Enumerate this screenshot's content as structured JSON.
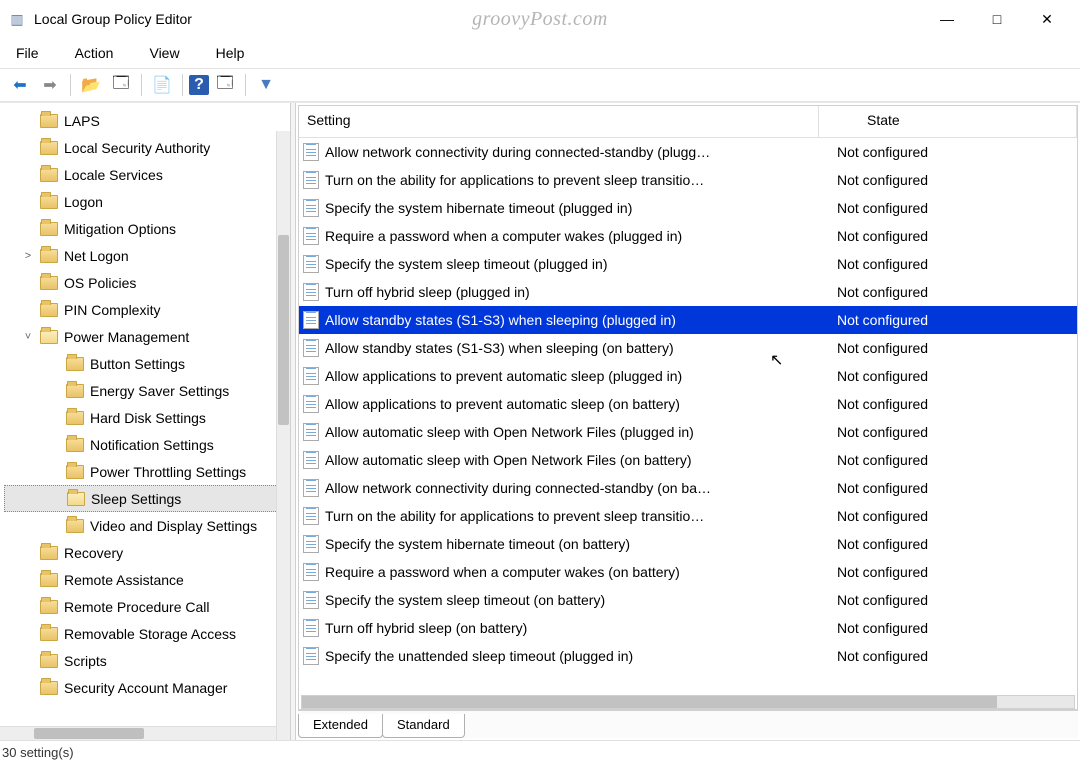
{
  "window": {
    "title": "Local Group Policy Editor",
    "watermark": "groovyPost.com"
  },
  "menubar": [
    "File",
    "Action",
    "View",
    "Help"
  ],
  "toolbar_icons": [
    "back",
    "forward",
    "up",
    "show-hide-tree",
    "export-list",
    "help",
    "show-hide-action",
    "filter"
  ],
  "tree": {
    "items": [
      {
        "label": "LAPS",
        "depth": 1,
        "expandable": false,
        "selected": false
      },
      {
        "label": "Local Security Authority",
        "depth": 1,
        "expandable": false,
        "selected": false
      },
      {
        "label": "Locale Services",
        "depth": 1,
        "expandable": false,
        "selected": false
      },
      {
        "label": "Logon",
        "depth": 1,
        "expandable": false,
        "selected": false
      },
      {
        "label": "Mitigation Options",
        "depth": 1,
        "expandable": false,
        "selected": false
      },
      {
        "label": "Net Logon",
        "depth": 1,
        "expandable": true,
        "expanded": false,
        "selected": false
      },
      {
        "label": "OS Policies",
        "depth": 1,
        "expandable": false,
        "selected": false
      },
      {
        "label": "PIN Complexity",
        "depth": 1,
        "expandable": false,
        "selected": false
      },
      {
        "label": "Power Management",
        "depth": 1,
        "expandable": true,
        "expanded": true,
        "selected": false
      },
      {
        "label": "Button Settings",
        "depth": 2,
        "expandable": false,
        "selected": false
      },
      {
        "label": "Energy Saver Settings",
        "depth": 2,
        "expandable": false,
        "selected": false
      },
      {
        "label": "Hard Disk Settings",
        "depth": 2,
        "expandable": false,
        "selected": false
      },
      {
        "label": "Notification Settings",
        "depth": 2,
        "expandable": false,
        "selected": false
      },
      {
        "label": "Power Throttling Settings",
        "depth": 2,
        "expandable": false,
        "selected": false
      },
      {
        "label": "Sleep Settings",
        "depth": 2,
        "expandable": false,
        "selected": true
      },
      {
        "label": "Video and Display Settings",
        "depth": 2,
        "expandable": false,
        "selected": false
      },
      {
        "label": "Recovery",
        "depth": 1,
        "expandable": false,
        "selected": false
      },
      {
        "label": "Remote Assistance",
        "depth": 1,
        "expandable": false,
        "selected": false
      },
      {
        "label": "Remote Procedure Call",
        "depth": 1,
        "expandable": false,
        "selected": false
      },
      {
        "label": "Removable Storage Access",
        "depth": 1,
        "expandable": false,
        "selected": false
      },
      {
        "label": "Scripts",
        "depth": 1,
        "expandable": false,
        "selected": false
      },
      {
        "label": "Security Account Manager",
        "depth": 1,
        "expandable": false,
        "selected": false
      }
    ]
  },
  "list": {
    "columns": {
      "setting": "Setting",
      "state": "State"
    },
    "rows": [
      {
        "setting": "Allow network connectivity during connected-standby (plugg…",
        "state": "Not configured",
        "selected": false
      },
      {
        "setting": "Turn on the ability for applications to prevent sleep transitio…",
        "state": "Not configured",
        "selected": false
      },
      {
        "setting": "Specify the system hibernate timeout (plugged in)",
        "state": "Not configured",
        "selected": false
      },
      {
        "setting": "Require a password when a computer wakes (plugged in)",
        "state": "Not configured",
        "selected": false
      },
      {
        "setting": "Specify the system sleep timeout (plugged in)",
        "state": "Not configured",
        "selected": false
      },
      {
        "setting": "Turn off hybrid sleep (plugged in)",
        "state": "Not configured",
        "selected": false
      },
      {
        "setting": "Allow standby states (S1-S3) when sleeping (plugged in)",
        "state": "Not configured",
        "selected": true
      },
      {
        "setting": "Allow standby states (S1-S3) when sleeping (on battery)",
        "state": "Not configured",
        "selected": false
      },
      {
        "setting": "Allow applications to prevent automatic sleep (plugged in)",
        "state": "Not configured",
        "selected": false
      },
      {
        "setting": "Allow applications to prevent automatic sleep (on battery)",
        "state": "Not configured",
        "selected": false
      },
      {
        "setting": "Allow automatic sleep with Open Network Files (plugged in)",
        "state": "Not configured",
        "selected": false
      },
      {
        "setting": "Allow automatic sleep with Open Network Files (on battery)",
        "state": "Not configured",
        "selected": false
      },
      {
        "setting": "Allow network connectivity during connected-standby (on ba…",
        "state": "Not configured",
        "selected": false
      },
      {
        "setting": "Turn on the ability for applications to prevent sleep transitio…",
        "state": "Not configured",
        "selected": false
      },
      {
        "setting": "Specify the system hibernate timeout (on battery)",
        "state": "Not configured",
        "selected": false
      },
      {
        "setting": "Require a password when a computer wakes (on battery)",
        "state": "Not configured",
        "selected": false
      },
      {
        "setting": "Specify the system sleep timeout (on battery)",
        "state": "Not configured",
        "selected": false
      },
      {
        "setting": "Turn off hybrid sleep (on battery)",
        "state": "Not configured",
        "selected": false
      },
      {
        "setting": "Specify the unattended sleep timeout (plugged in)",
        "state": "Not configured",
        "selected": false
      }
    ]
  },
  "tabs": {
    "extended": "Extended",
    "standard": "Standard",
    "active": "standard"
  },
  "statusbar": "30 setting(s)"
}
